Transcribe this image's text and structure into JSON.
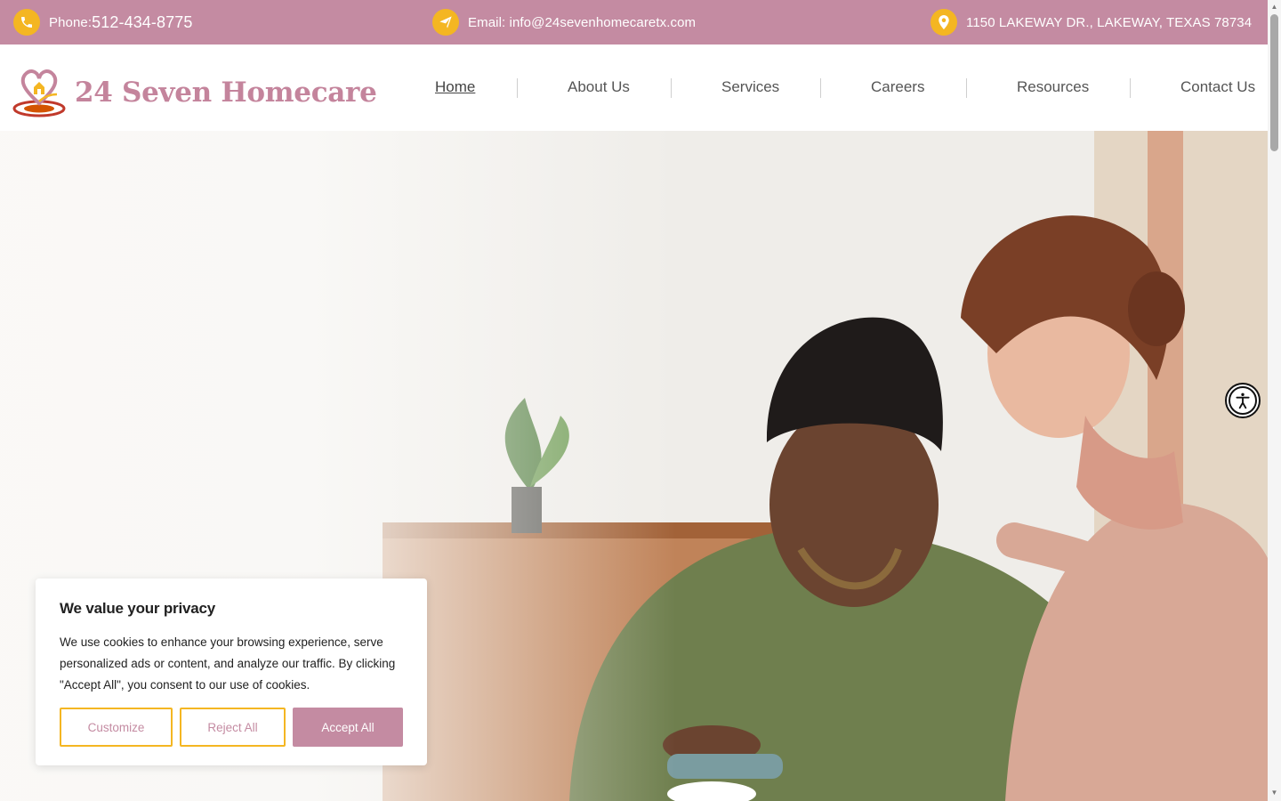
{
  "topbar": {
    "phone_label": "Phone: ",
    "phone_number": "512-434-8775",
    "email": "Email: info@24sevenhomecaretx.com",
    "address": "1150 LAKEWAY DR., LAKEWAY, TEXAS 78734",
    "icons": [
      "phone-icon",
      "paper-plane-icon",
      "map-pin-icon"
    ]
  },
  "header": {
    "logo_text": "24 Seven Homecare",
    "nav": [
      {
        "label": "Home",
        "active": true
      },
      {
        "label": "About Us",
        "active": false
      },
      {
        "label": "Services",
        "active": false
      },
      {
        "label": "Careers",
        "active": false
      },
      {
        "label": "Resources",
        "active": false
      },
      {
        "label": "Contact Us",
        "active": false
      }
    ]
  },
  "cookie_banner": {
    "title": "We value your privacy",
    "body": "We use cookies to enhance your browsing experience, serve personalized ads or content, and analyze our traffic. By clicking \"Accept All\", you consent to our use of cookies.",
    "buttons": {
      "customize": "Customize",
      "reject": "Reject All",
      "accept": "Accept All"
    }
  },
  "colors": {
    "brand_mauve": "#c48ba2",
    "accent_gold": "#f4b622",
    "nav_text": "#555555"
  }
}
